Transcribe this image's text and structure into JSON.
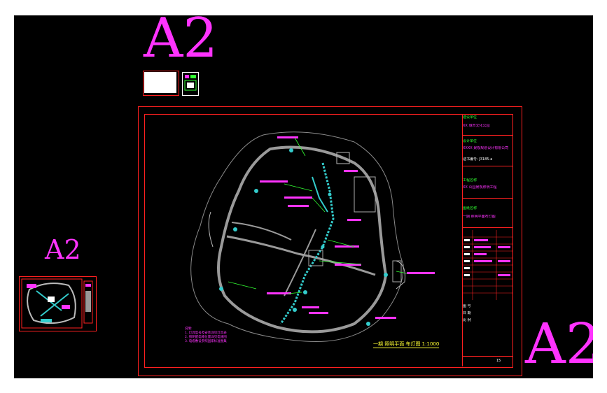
{
  "labels": {
    "a2_top": "A2",
    "a2_left": "A2",
    "a2_right": "A2"
  },
  "title_block": {
    "rows": [
      {
        "text": "建设单位",
        "color": "green"
      },
      {
        "text": "XX 城市文化公园",
        "color": "magenta"
      },
      {
        "text": "设计单位",
        "color": "green"
      },
      {
        "text": "XXXX 景观规划设计有限公司",
        "color": "magenta"
      },
      {
        "text": "证书编号: J3185-a",
        "color": "white"
      },
      {
        "text": "工程名称",
        "color": "green"
      },
      {
        "text": "XX 公园景观照明工程",
        "color": "magenta"
      },
      {
        "text": "图纸名称",
        "color": "green"
      },
      {
        "text": "一期 照明平面布灯图",
        "color": "magenta"
      },
      {
        "text": "图 号",
        "color": "white"
      },
      {
        "text": "日 期",
        "color": "white"
      },
      {
        "text": "比 例",
        "color": "white"
      }
    ],
    "sheet_no": "15"
  },
  "plan": {
    "scale_caption": "一期 照明平面 布灯图 1:1000",
    "notes": [
      "说明:",
      "1. 灯具型号及安装详见灯具表",
      "2. 照明配电箱位置详见电施图",
      "3. 电缆敷设参照国家标准图集"
    ]
  },
  "colors": {
    "background": "#000000",
    "frame": "#ffffff",
    "sheet_border": "#ff2020",
    "label": "#ff33ff",
    "path": "#9a9a9a",
    "lighting": "#33cccc",
    "annotation": "#ff33ff",
    "leader": "#33ff33"
  }
}
